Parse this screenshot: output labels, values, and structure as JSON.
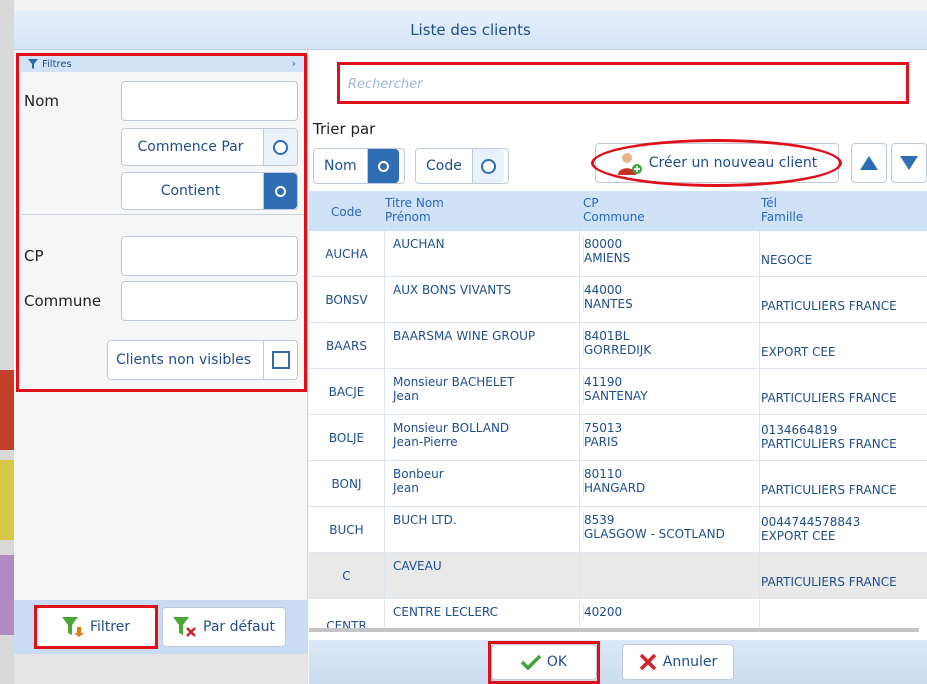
{
  "window": {
    "title": "Liste des clients"
  },
  "filters": {
    "header": "Filtres",
    "nom_label": "Nom",
    "nom_value": "",
    "commence_par": "Commence Par",
    "contient": "Contient",
    "cp_label": "CP",
    "cp_value": "",
    "commune_label": "Commune",
    "commune_value": "",
    "clients_non_visibles": "Clients non visibles",
    "filtrer_button": "Filtrer",
    "par_defaut_button": "Par défaut"
  },
  "search": {
    "placeholder": "Rechercher"
  },
  "sort": {
    "label": "Trier par",
    "nom": "Nom",
    "code": "Code",
    "new_client_button": "Créer un nouveau client"
  },
  "table": {
    "headers": {
      "code": "Code",
      "titre_nom": "Titre Nom",
      "prenom": "Prénom",
      "cp": "CP",
      "commune": "Commune",
      "tel": "Tél",
      "famille": "Famille"
    },
    "rows": [
      {
        "code": "AUCHA",
        "nom": "AUCHAN",
        "prenom": "",
        "cp": "80000",
        "commune": "AMIENS",
        "tel": "",
        "famille": "NEGOCE"
      },
      {
        "code": "BONSV",
        "nom": "AUX BONS VIVANTS",
        "prenom": "",
        "cp": "44000",
        "commune": "NANTES",
        "tel": "",
        "famille": "PARTICULIERS FRANCE"
      },
      {
        "code": "BAARS",
        "nom": "BAARSMA WINE GROUP",
        "prenom": "",
        "cp": "8401BL",
        "commune": "GORREDIJK",
        "tel": "",
        "famille": "EXPORT CEE"
      },
      {
        "code": "BACJE",
        "nom": "Monsieur BACHELET",
        "prenom": "Jean",
        "cp": "41190",
        "commune": "SANTENAY",
        "tel": "",
        "famille": "PARTICULIERS FRANCE"
      },
      {
        "code": "BOLJE",
        "nom": "Monsieur BOLLAND",
        "prenom": "Jean-Pierre",
        "cp": "75013",
        "commune": "PARIS",
        "tel": "0134664819",
        "famille": "PARTICULIERS FRANCE"
      },
      {
        "code": "BONJ",
        "nom": "Bonbeur",
        "prenom": "Jean",
        "cp": "80110",
        "commune": "HANGARD",
        "tel": "",
        "famille": "PARTICULIERS FRANCE"
      },
      {
        "code": "BUCH",
        "nom": "BUCH LTD.",
        "prenom": "",
        "cp": "8539",
        "commune": "GLASGOW - SCOTLAND",
        "tel": "0044744578843",
        "famille": "EXPORT CEE"
      },
      {
        "code": "C",
        "nom": "CAVEAU",
        "prenom": "",
        "cp": "",
        "commune": "",
        "tel": "",
        "famille": "PARTICULIERS FRANCE"
      },
      {
        "code": "CENTR",
        "nom": "CENTRE LECLERC",
        "prenom": "",
        "cp": "40200",
        "commune": "",
        "tel": "",
        "famille": ""
      }
    ]
  },
  "footer": {
    "ok": "OK",
    "annuler": "Annuler"
  },
  "colors": {
    "accent": "#2f6db5",
    "highlight": "#e0101a",
    "header_bg": "#d0e2f7"
  }
}
